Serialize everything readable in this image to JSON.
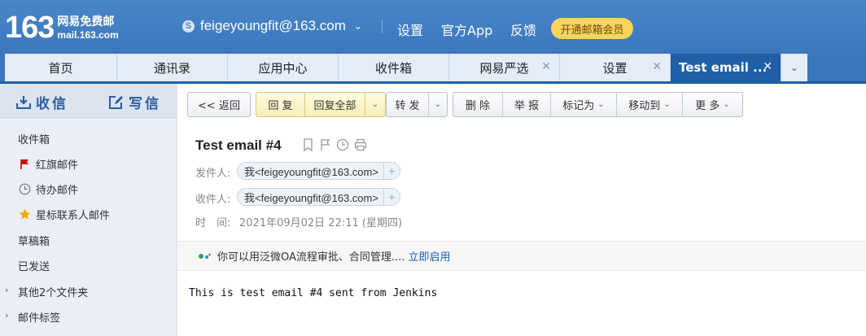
{
  "brand": {
    "logo_number": "163",
    "logo_text": "网易免费邮",
    "domain": "mail.163.com"
  },
  "account": {
    "email": "feigeyoungfit@163.com",
    "coin_icon": "S"
  },
  "header_links": [
    "设置",
    "官方App",
    "反馈"
  ],
  "vip_button": "开通邮箱会员",
  "tabs": [
    {
      "label": "首页"
    },
    {
      "label": "通讯录"
    },
    {
      "label": "应用中心"
    },
    {
      "label": "收件箱"
    },
    {
      "label": "网易严选",
      "closable": true
    },
    {
      "label": "设置",
      "closable": true
    },
    {
      "label": "Test email ...",
      "closable": true,
      "active": true
    }
  ],
  "compose": {
    "receive": "收信",
    "write": "写信"
  },
  "sidebar": {
    "items": [
      {
        "label": "收件箱"
      },
      {
        "label": "红旗邮件",
        "icon": "red-flag-icon"
      },
      {
        "label": "待办邮件",
        "icon": "clock-icon"
      },
      {
        "label": "星标联系人邮件",
        "icon": "star-icon"
      },
      {
        "label": "草稿箱"
      },
      {
        "label": "已发送"
      },
      {
        "label": "其他2个文件夹",
        "collapsible": true
      },
      {
        "label": "邮件标签",
        "collapsible": true
      }
    ]
  },
  "toolbar": {
    "back": "<< 返回",
    "reply": "回 复",
    "reply_all": "回复全部",
    "forward": "转 发",
    "delete": "删 除",
    "report": "举 报",
    "mark_as": "标记为",
    "move_to": "移动到",
    "more": "更 多"
  },
  "message": {
    "subject": "Test email #4",
    "from_label": "发件人:",
    "from": "我<feigeyoungfit@163.com>",
    "to_label": "收件人:",
    "to": "我<feigeyoungfit@163.com>",
    "time_label": "时　间:",
    "time": "2021年09月02日 22:11 (星期四)",
    "body": "This is test email #4 sent from Jenkins"
  },
  "banner": {
    "text": "你可以用泛微OA流程审批、合同管理....",
    "link": "立即启用"
  },
  "colors": {
    "header_blue": "#3a77bd",
    "active_tab": "#1e5fa6",
    "vip_yellow": "#f7d55a",
    "link_blue": "#1b5fb3"
  }
}
